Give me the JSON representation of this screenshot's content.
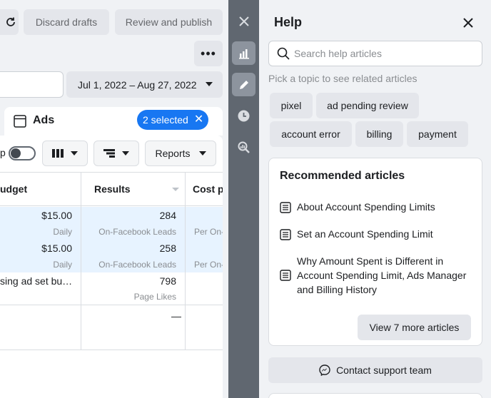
{
  "toolbar": {
    "discard_label": "Discard drafts",
    "review_label": "Review and publish",
    "date_range": "Jul 1, 2022 – Aug 27, 2022"
  },
  "tab": {
    "title": "Ads",
    "selected_badge": "2 selected"
  },
  "controls": {
    "toggle_prefix": "p",
    "reports_label": "Reports"
  },
  "table": {
    "headers": {
      "budget": "udget",
      "results": "Results",
      "cost": "Cost pe"
    },
    "rows": [
      {
        "budget": "$15.00",
        "budget_sub": "Daily",
        "results": "284",
        "results_sub": "On-Facebook Leads",
        "cost_sub": "Per On-"
      },
      {
        "budget": "$15.00",
        "budget_sub": "Daily",
        "results": "258",
        "results_sub": "On-Facebook Leads",
        "cost_sub": "Per On-"
      },
      {
        "budget": "sing ad set bu…",
        "budget_sub": "",
        "results": "798",
        "results_sub": "Page Likes",
        "cost_sub": ""
      }
    ],
    "total": {
      "results": "—"
    }
  },
  "help": {
    "title": "Help",
    "search_placeholder": "Search help articles",
    "topic_prompt": "Pick a topic to see related articles",
    "topics": [
      "pixel",
      "ad pending review",
      "account error",
      "billing",
      "payment"
    ],
    "recommended_title": "Recommended articles",
    "articles": [
      "About Account Spending Limits",
      "Set an Account Spending Limit",
      "Why Amount Spent is Different in Account Spending Limit, Ads Manager and Billing History"
    ],
    "view_more_label": "View 7 more articles",
    "contact_label": "Contact support team"
  }
}
